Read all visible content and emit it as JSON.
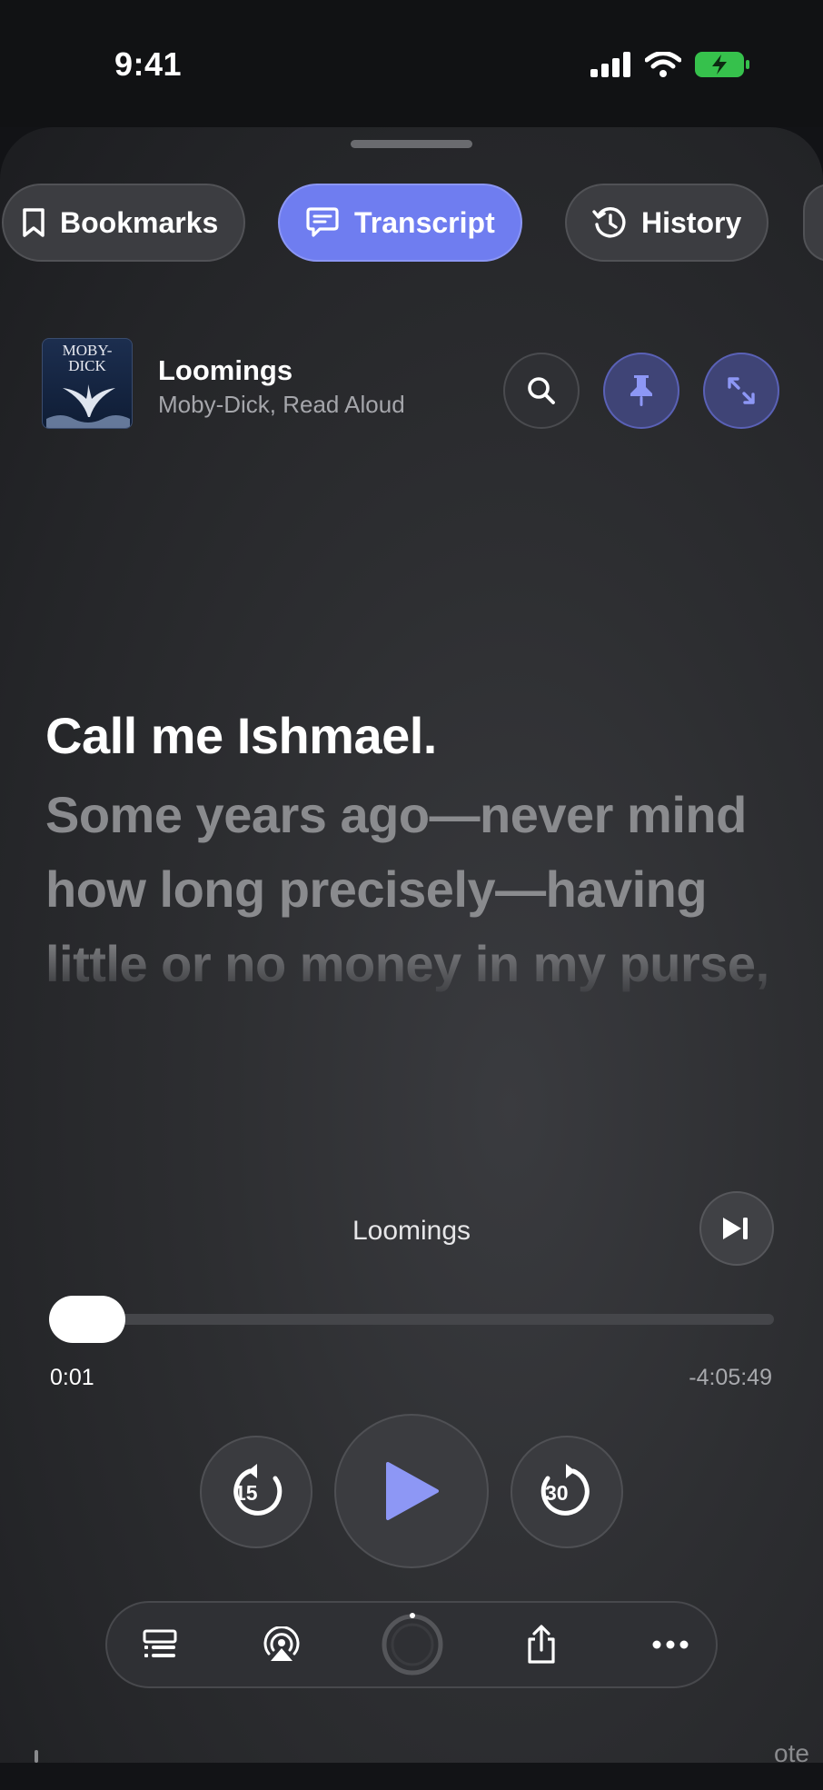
{
  "status_bar": {
    "time": "9:41"
  },
  "tabs": [
    {
      "label": "Bookmarks",
      "icon": "bookmark-icon",
      "active": false
    },
    {
      "label": "Transcript",
      "icon": "chat-bubble-icon",
      "active": true
    },
    {
      "label": "History",
      "icon": "history-icon",
      "active": false
    }
  ],
  "now_playing": {
    "cover_text": "MOBY-DICK",
    "title": "Loomings",
    "subtitle": "Moby-Dick, Read Aloud"
  },
  "transcript": {
    "current_line": "Call me Ishmael.",
    "next_line": "Some years ago—never mind how long precisely—having little or no money in my purse,"
  },
  "player": {
    "chapter": "Loomings",
    "elapsed": "0:01",
    "remaining": "-4:05:49",
    "progress_fraction": 0.0001,
    "skip_back_seconds": "15",
    "skip_forward_seconds": "30"
  },
  "bottom_peek_text": "ote",
  "colors": {
    "accent": "#6f7df0",
    "background": "#2d2e31"
  }
}
